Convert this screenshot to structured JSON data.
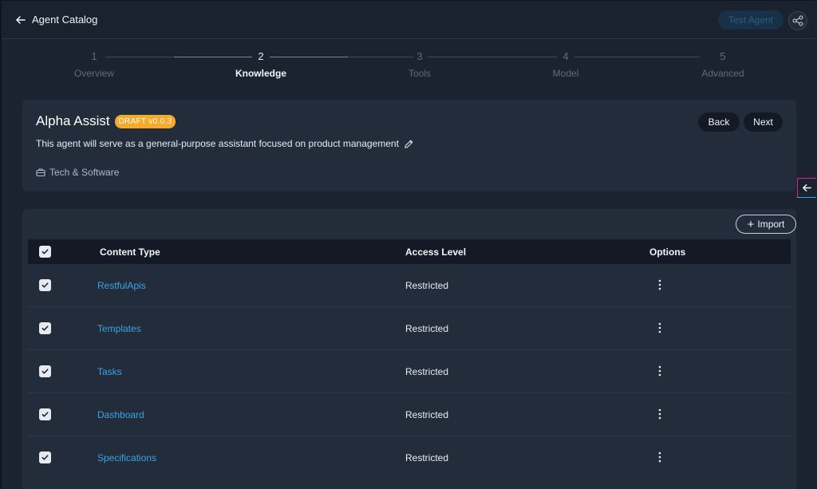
{
  "header": {
    "back_label": "Agent Catalog",
    "test_agent_label": "Test Agent"
  },
  "stepper": {
    "steps": [
      {
        "num": "1",
        "label": "Overview"
      },
      {
        "num": "2",
        "label": "Knowledge"
      },
      {
        "num": "3",
        "label": "Tools"
      },
      {
        "num": "4",
        "label": "Model"
      },
      {
        "num": "5",
        "label": "Advanced"
      }
    ],
    "current_step": 2
  },
  "agent": {
    "name": "Alpha Assist",
    "badge": "DRAFT v0.0.3",
    "description": "This agent will serve as a general-purpose assistant focused on product management",
    "category": "Tech & Software",
    "back_label": "Back",
    "next_label": "Next"
  },
  "knowledge": {
    "import_label": "Import",
    "columns": {
      "content_type": "Content Type",
      "access_level": "Access Level",
      "options": "Options"
    },
    "rows": [
      {
        "content_type": "RestfulApis",
        "access_level": "Restricted",
        "checked": true
      },
      {
        "content_type": "Templates",
        "access_level": "Restricted",
        "checked": true
      },
      {
        "content_type": "Tasks",
        "access_level": "Restricted",
        "checked": true
      },
      {
        "content_type": "Dashboard",
        "access_level": "Restricted",
        "checked": true
      },
      {
        "content_type": "Specifications",
        "access_level": "Restricted",
        "checked": true
      }
    ]
  },
  "colors": {
    "background": "#1b2331",
    "card": "#222c3b",
    "accent_link": "#3aa3e8",
    "badge": "#f7a928"
  },
  "icons": {
    "back": "arrow-left-icon",
    "share": "share-icon",
    "edit": "pencil-icon",
    "category": "briefcase-icon",
    "options": "more-vertical-icon",
    "side_toggle": "arrow-left-icon"
  }
}
